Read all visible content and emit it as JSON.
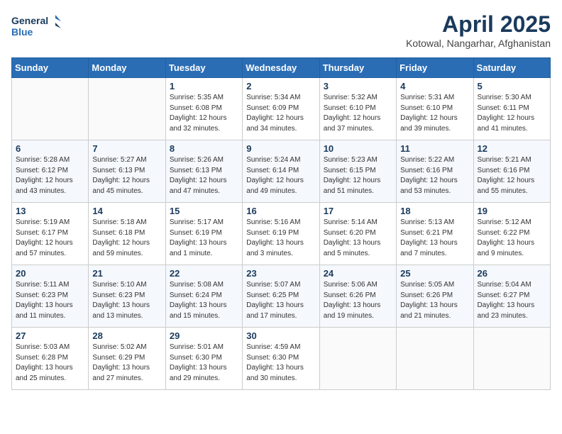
{
  "logo": {
    "line1": "General",
    "line2": "Blue"
  },
  "title": "April 2025",
  "location": "Kotowal, Nangarhar, Afghanistan",
  "weekdays": [
    "Sunday",
    "Monday",
    "Tuesday",
    "Wednesday",
    "Thursday",
    "Friday",
    "Saturday"
  ],
  "weeks": [
    [
      {
        "day": "",
        "info": ""
      },
      {
        "day": "",
        "info": ""
      },
      {
        "day": "1",
        "info": "Sunrise: 5:35 AM\nSunset: 6:08 PM\nDaylight: 12 hours\nand 32 minutes."
      },
      {
        "day": "2",
        "info": "Sunrise: 5:34 AM\nSunset: 6:09 PM\nDaylight: 12 hours\nand 34 minutes."
      },
      {
        "day": "3",
        "info": "Sunrise: 5:32 AM\nSunset: 6:10 PM\nDaylight: 12 hours\nand 37 minutes."
      },
      {
        "day": "4",
        "info": "Sunrise: 5:31 AM\nSunset: 6:10 PM\nDaylight: 12 hours\nand 39 minutes."
      },
      {
        "day": "5",
        "info": "Sunrise: 5:30 AM\nSunset: 6:11 PM\nDaylight: 12 hours\nand 41 minutes."
      }
    ],
    [
      {
        "day": "6",
        "info": "Sunrise: 5:28 AM\nSunset: 6:12 PM\nDaylight: 12 hours\nand 43 minutes."
      },
      {
        "day": "7",
        "info": "Sunrise: 5:27 AM\nSunset: 6:13 PM\nDaylight: 12 hours\nand 45 minutes."
      },
      {
        "day": "8",
        "info": "Sunrise: 5:26 AM\nSunset: 6:13 PM\nDaylight: 12 hours\nand 47 minutes."
      },
      {
        "day": "9",
        "info": "Sunrise: 5:24 AM\nSunset: 6:14 PM\nDaylight: 12 hours\nand 49 minutes."
      },
      {
        "day": "10",
        "info": "Sunrise: 5:23 AM\nSunset: 6:15 PM\nDaylight: 12 hours\nand 51 minutes."
      },
      {
        "day": "11",
        "info": "Sunrise: 5:22 AM\nSunset: 6:16 PM\nDaylight: 12 hours\nand 53 minutes."
      },
      {
        "day": "12",
        "info": "Sunrise: 5:21 AM\nSunset: 6:16 PM\nDaylight: 12 hours\nand 55 minutes."
      }
    ],
    [
      {
        "day": "13",
        "info": "Sunrise: 5:19 AM\nSunset: 6:17 PM\nDaylight: 12 hours\nand 57 minutes."
      },
      {
        "day": "14",
        "info": "Sunrise: 5:18 AM\nSunset: 6:18 PM\nDaylight: 12 hours\nand 59 minutes."
      },
      {
        "day": "15",
        "info": "Sunrise: 5:17 AM\nSunset: 6:19 PM\nDaylight: 13 hours\nand 1 minute."
      },
      {
        "day": "16",
        "info": "Sunrise: 5:16 AM\nSunset: 6:19 PM\nDaylight: 13 hours\nand 3 minutes."
      },
      {
        "day": "17",
        "info": "Sunrise: 5:14 AM\nSunset: 6:20 PM\nDaylight: 13 hours\nand 5 minutes."
      },
      {
        "day": "18",
        "info": "Sunrise: 5:13 AM\nSunset: 6:21 PM\nDaylight: 13 hours\nand 7 minutes."
      },
      {
        "day": "19",
        "info": "Sunrise: 5:12 AM\nSunset: 6:22 PM\nDaylight: 13 hours\nand 9 minutes."
      }
    ],
    [
      {
        "day": "20",
        "info": "Sunrise: 5:11 AM\nSunset: 6:23 PM\nDaylight: 13 hours\nand 11 minutes."
      },
      {
        "day": "21",
        "info": "Sunrise: 5:10 AM\nSunset: 6:23 PM\nDaylight: 13 hours\nand 13 minutes."
      },
      {
        "day": "22",
        "info": "Sunrise: 5:08 AM\nSunset: 6:24 PM\nDaylight: 13 hours\nand 15 minutes."
      },
      {
        "day": "23",
        "info": "Sunrise: 5:07 AM\nSunset: 6:25 PM\nDaylight: 13 hours\nand 17 minutes."
      },
      {
        "day": "24",
        "info": "Sunrise: 5:06 AM\nSunset: 6:26 PM\nDaylight: 13 hours\nand 19 minutes."
      },
      {
        "day": "25",
        "info": "Sunrise: 5:05 AM\nSunset: 6:26 PM\nDaylight: 13 hours\nand 21 minutes."
      },
      {
        "day": "26",
        "info": "Sunrise: 5:04 AM\nSunset: 6:27 PM\nDaylight: 13 hours\nand 23 minutes."
      }
    ],
    [
      {
        "day": "27",
        "info": "Sunrise: 5:03 AM\nSunset: 6:28 PM\nDaylight: 13 hours\nand 25 minutes."
      },
      {
        "day": "28",
        "info": "Sunrise: 5:02 AM\nSunset: 6:29 PM\nDaylight: 13 hours\nand 27 minutes."
      },
      {
        "day": "29",
        "info": "Sunrise: 5:01 AM\nSunset: 6:30 PM\nDaylight: 13 hours\nand 29 minutes."
      },
      {
        "day": "30",
        "info": "Sunrise: 4:59 AM\nSunset: 6:30 PM\nDaylight: 13 hours\nand 30 minutes."
      },
      {
        "day": "",
        "info": ""
      },
      {
        "day": "",
        "info": ""
      },
      {
        "day": "",
        "info": ""
      }
    ]
  ]
}
